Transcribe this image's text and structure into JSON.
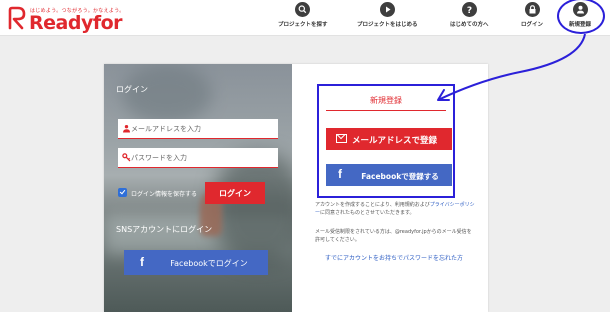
{
  "header": {
    "logo_tagline": "はじめよう。つながろう。かなえよう。",
    "logo_text": "Readyfor",
    "nav": [
      {
        "label": "プロジェクトを探す",
        "icon": "search-icon"
      },
      {
        "label": "プロジェクトをはじめる",
        "icon": "play-icon"
      },
      {
        "label": "はじめての方へ",
        "icon": "question-icon"
      },
      {
        "label": "ログイン",
        "icon": "lock-icon"
      },
      {
        "label": "新規登録",
        "icon": "user-icon"
      }
    ]
  },
  "login": {
    "title": "ログイン",
    "email_placeholder": "メールアドレスを入力",
    "password_placeholder": "パスワードを入力",
    "remember_label": "ログイン情報を保存する",
    "remember_checked": true,
    "login_button": "ログイン",
    "sns_title": "SNSアカウントにログイン",
    "facebook_login": "Facebookでログイン"
  },
  "signup": {
    "title": "新規登録",
    "email_button": "メールアドレスで登録",
    "facebook_button": "Facebookで登録する",
    "terms_pre": "アカウントを作成することにより、利用規約および",
    "terms_link": "プライバシーポリシー",
    "terms_post": "に同意されたものとさせていただきます。",
    "mail_note": "メール受信制限をされている方は、@readyfor.jpからのメール受信を許可してください。",
    "existing_link": "すでにアカウントをお持ちでパスワードを忘れた方"
  },
  "colors": {
    "brand_red": "#e0282e",
    "facebook_blue": "#4468c4",
    "annotation_blue": "#2b20d9"
  }
}
